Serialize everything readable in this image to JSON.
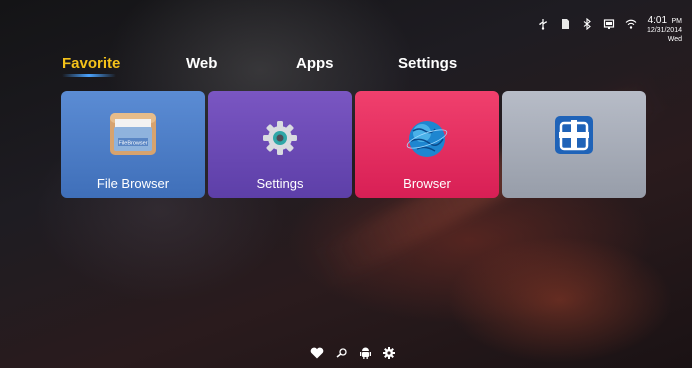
{
  "status": {
    "time": "4:01",
    "ampm": "PM",
    "date": "12/31/2014",
    "day": "Wed",
    "icons": [
      "usb-icon",
      "sd-card-icon",
      "bluetooth-icon",
      "cast-icon",
      "wifi-icon"
    ]
  },
  "tabs": [
    {
      "label": "Favorite",
      "active": true
    },
    {
      "label": "Web",
      "active": false
    },
    {
      "label": "Apps",
      "active": false
    },
    {
      "label": "Settings",
      "active": false
    }
  ],
  "tiles": [
    {
      "label": "File Browser",
      "icon": "file-browser-icon",
      "icon_text": "FileBrowser",
      "color": "#4a7cc6"
    },
    {
      "label": "Settings",
      "icon": "gear-icon",
      "color": "#6a4ab5"
    },
    {
      "label": "Browser",
      "icon": "globe-icon",
      "color": "#e32e62"
    },
    {
      "label": "",
      "icon": "add-icon",
      "color": "#a7adb8"
    }
  ],
  "bottom_nav": [
    "heart-icon",
    "search-icon",
    "android-icon",
    "gear-icon"
  ],
  "colors": {
    "active_tab": "#f4c21a",
    "tab_underline": "#4aa3ff"
  }
}
